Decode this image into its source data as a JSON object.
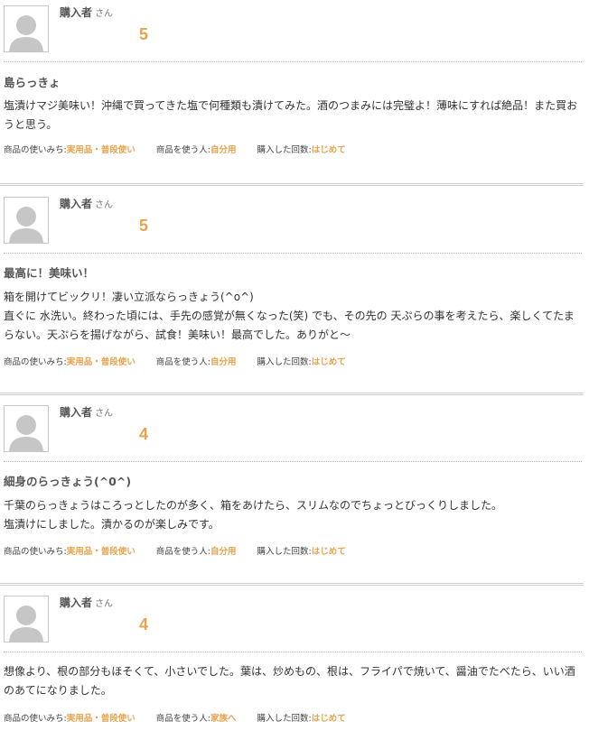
{
  "reviews": [
    {
      "reviewer": "購入者",
      "suffix": "さん",
      "rating": "5",
      "title": "島らっきょ",
      "body": [
        "塩漬けマジ美味い！沖縄で買ってきた塩で何種類も漬けてみた。酒のつまみには完璧よ！薄味にすれば絶品！また買おうと思う。"
      ],
      "usage_label": "商品の使いみち:",
      "usage": "実用品・普段使い",
      "user_label": "商品を使う人:",
      "user": "自分用",
      "count_label": "購入した回数:",
      "count": "はじめて"
    },
    {
      "reviewer": "購入者",
      "suffix": "さん",
      "rating": "5",
      "title": "最高に！美味い！",
      "body": [
        "箱を開けてビックリ！凄い立派ならっきょう(^o^)",
        "直ぐに 水洗い。終わった頃には、手先の感覚が無くなった(笑) でも、その先の 天ぷらの事を考えたら、楽しくてたまらない。天ぷらを揚げながら、試食！美味い！最高でした。ありがと〜"
      ],
      "usage_label": "商品の使いみち:",
      "usage": "実用品・普段使い",
      "user_label": "商品を使う人:",
      "user": "自分用",
      "count_label": "購入した回数:",
      "count": "はじめて"
    },
    {
      "reviewer": "購入者",
      "suffix": "さん",
      "rating": "4",
      "title": "細身のらっきょう(^0^)",
      "body": [
        "千葉のらっきょうはころっとしたのが多く、箱をあけたら、スリムなのでちょっとびっくりしました。",
        "塩漬けにしました。漬かるのが楽しみです。"
      ],
      "usage_label": "商品の使いみち:",
      "usage": "実用品・普段使い",
      "user_label": "商品を使う人:",
      "user": "自分用",
      "count_label": "購入した回数:",
      "count": "はじめて"
    },
    {
      "reviewer": "購入者",
      "suffix": "さん",
      "rating": "4",
      "title": "",
      "body": [
        "想像より、根の部分もほそくて、小さいでした。葉は、炒めもの、根は、フライパで焼いて、醤油でたべたら、いい酒のあてになりました。"
      ],
      "usage_label": "商品の使いみち:",
      "usage": "実用品・普段使い",
      "user_label": "商品を使う人:",
      "user": "家族へ",
      "count_label": "購入した回数:",
      "count": "はじめて"
    }
  ]
}
